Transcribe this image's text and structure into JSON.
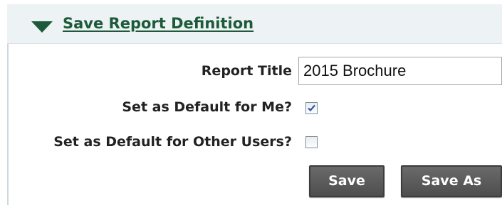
{
  "section": {
    "title": "Save Report Definition",
    "collapse_icon": "triangle-down-icon"
  },
  "form": {
    "report_title_label": "Report Title",
    "report_title_value": "2015 Brochure",
    "default_me_label": "Set as Default for Me?",
    "default_me_checked": true,
    "default_others_label": "Set as Default for Other Users?",
    "default_others_checked": false
  },
  "buttons": {
    "save_label": "Save",
    "save_as_label": "Save As"
  },
  "colors": {
    "accent_green": "#1d5a3a",
    "header_bg": "#edf2f4",
    "button_bg": "#5a5a5a"
  }
}
